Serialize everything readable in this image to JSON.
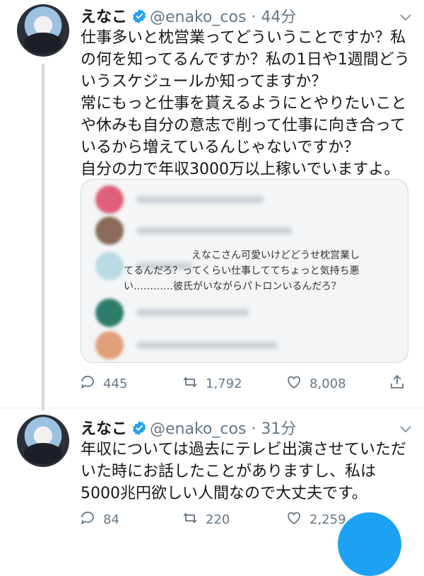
{
  "tweets": [
    {
      "name": "えなこ",
      "handle": "@enako_cos",
      "separator": "·",
      "time": "44分",
      "text": "仕事多いと枕営業ってどういうことですか？私の何を知ってるんですか？私の1日や1週間どういうスケジュールか知ってますか？\n常にもっと仕事を貰えるようにとやりたいことや休みも自分の意志で削って仕事に向き合っているから増えているんじゃないですか？\n自分の力で年収3000万以上稼いでいますよ。",
      "embed": {
        "reply_text": "えなこさん可愛いけどどうせ枕営業し",
        "reply_text2": "てるんだろ？ってくらい仕事しててちょっと気持ち悪い…………彼氏がいながらパトロンいるんだろ？"
      },
      "replies": "445",
      "retweets": "1,792",
      "likes": "8,008"
    },
    {
      "name": "えなこ",
      "handle": "@enako_cos",
      "separator": "·",
      "time": "31分",
      "text": "年収については過去にテレビ出演させていただいた時にお話したことがありますし、私は5000兆円欲しい人間なので大丈夫です。",
      "replies": "84",
      "retweets": "220",
      "likes": "2,259"
    }
  ],
  "colors": {
    "verified": "#1da1f2",
    "secondary_text": "#657786",
    "accent": "#1da1f2"
  },
  "icons": [
    "verified-badge-icon",
    "chevron-down-icon",
    "reply-icon",
    "retweet-icon",
    "like-icon",
    "share-icon"
  ]
}
